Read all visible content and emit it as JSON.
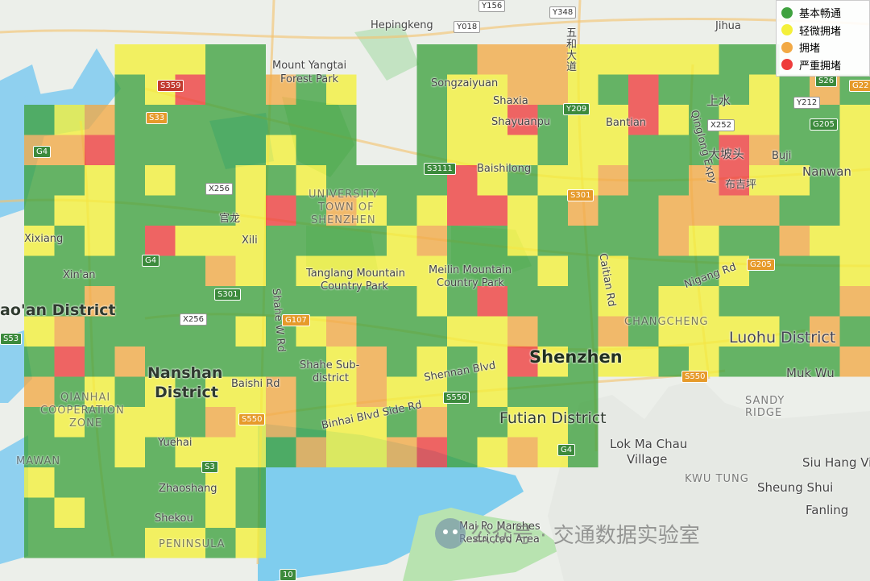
{
  "legend": {
    "items": [
      {
        "label": "基本畅通",
        "color": "#3fa23f"
      },
      {
        "label": "轻微拥堵",
        "color": "#f4f03a"
      },
      {
        "label": "拥堵",
        "color": "#f2a945"
      },
      {
        "label": "严重拥堵",
        "color": "#ee3c3c"
      }
    ]
  },
  "labels": {
    "mount_yangtai": "Mount Yangtai",
    "forest_park": "Forest Park",
    "hepingkeng": "Hepingkeng",
    "jihua": "Jihua",
    "songzaiyuan": "Songzaiyuan",
    "shaxia": "Shaxia",
    "shayuanpu": "Shayuanpu",
    "bantian": "Bantian",
    "shangshui": "上水",
    "dapotou": "大坡头",
    "buji": "Buji",
    "nanwan": "Nanwan",
    "baishilong": "Baishilong",
    "bujiping": "布吉坪",
    "university_town_1": "UNIVERSITY",
    "university_town_2": "TOWN OF",
    "university_town_3": "SHENZHEN",
    "guanlong": "官龙",
    "xili": "Xili",
    "xixiang": "Xixiang",
    "xinan": "Xin'an",
    "baoan": "ao'an District",
    "tanglang_1": "Tanglang Mountain",
    "tanglang_2": "Country Park",
    "meilin_1": "Meilin Mountain",
    "meilin_2": "Country Park",
    "changcheng": "CHANGCHENG",
    "luohu": "Luohu District",
    "nanshan_1": "Nanshan",
    "nanshan_2": "District",
    "shenzhen": "Shenzhen",
    "shahe_1": "Shahe Sub-",
    "shahe_2": "district",
    "baishi_rd": "Baishi Rd",
    "shennan_blvd": "Shennan Blvd",
    "binhai_blvd": "Binhai Blvd Side Rd",
    "futian": "Futian District",
    "qianhai_1": "QIANHAI",
    "qianhai_2": "COOPERATION",
    "qianhai_3": "ZONE",
    "mawan": "MAWAN",
    "yuehai": "Yuehai",
    "zhaoshang": "Zhaoshang",
    "shekou": "Shekou",
    "peninsula": "PENINSULA",
    "muk_wu": "Muk Wu",
    "sandy_ridge_1": "SANDY",
    "sandy_ridge_2": "RIDGE",
    "lok_ma_chau_1": "Lok Ma Chau",
    "lok_ma_chau_2": "Village",
    "siu_hang": "Siu Hang Vi",
    "kwu_tung": "KWU TUNG",
    "sheung_shui": "Sheung Shui",
    "fanling": "Fanling",
    "mai_po_1": "Mai Po Marshes",
    "mai_po_2": "Restricted Area",
    "caitian_rd": "Caitian Rd",
    "nigang_rd": "Nigang Rd",
    "qinglong_expy": "Qinglong Expy",
    "shahe_w_rd": "Shahe W Rd",
    "wuhe_1": "五",
    "wuhe_2": "和",
    "wuhe_3": "大",
    "wuhe_4": "道"
  },
  "shields": {
    "y156": "Y156",
    "y348": "Y348",
    "y018": "Y018",
    "s359": "S359",
    "s33": "S33",
    "g4_a": "G4",
    "x256_a": "X256",
    "g4_b": "G4",
    "s301_a": "S301",
    "x256_b": "X256",
    "g107": "G107",
    "s53": "S53",
    "s550_a": "S550",
    "s3": "S3",
    "s3111": "S3111",
    "y209": "Y209",
    "s301_b": "S301",
    "x252": "X252",
    "y212": "Y212",
    "g205_a": "G205",
    "g205_b": "G205",
    "s550_b": "S550",
    "s550_c": "S550",
    "g4_c": "G4",
    "r10": "10",
    "s26": "S26",
    "g22": "G22"
  },
  "watermark": {
    "text": "公众号 · 交通数据实验室"
  }
}
